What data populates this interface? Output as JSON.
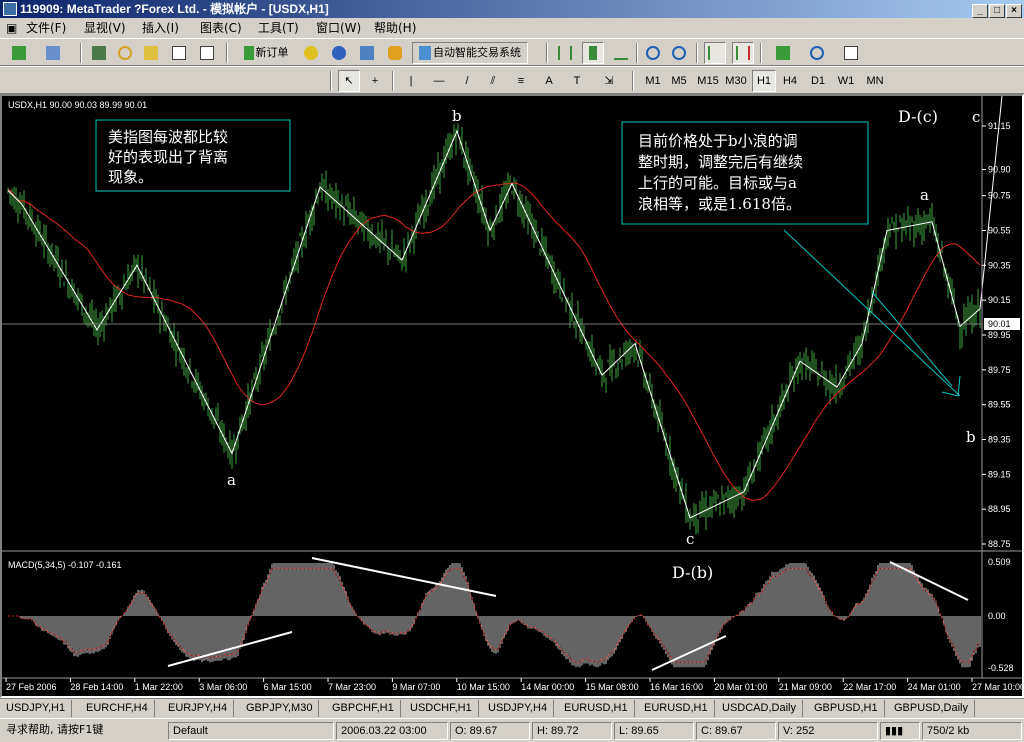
{
  "window": {
    "title": "119909: MetaTrader ?Forex Ltd. - 模拟帐户 - [USDX,H1]",
    "min": "_",
    "max": "□",
    "close": "×"
  },
  "menu": [
    "文件(F)",
    "显视(V)",
    "插入(I)",
    "图表(C)",
    "工具(T)",
    "窗口(W)",
    "帮助(H)"
  ],
  "toolbar": {
    "new_order": "新订单",
    "expert": "自动智能交易系统",
    "timeframes": [
      "M1",
      "M5",
      "M15",
      "M30",
      "H1",
      "H4",
      "D1",
      "W1",
      "MN"
    ],
    "active_timeframe": "H1"
  },
  "chart": {
    "header": "USDX,H1  90.00 90.03 89.99 90.01",
    "current_price": "90.01",
    "price_ticks": [
      "91.15",
      "90.90",
      "90.75",
      "90.55",
      "90.35",
      "90.15",
      "89.95",
      "89.75",
      "89.55",
      "89.35",
      "89.15",
      "88.95",
      "88.75"
    ],
    "macd_header": "MACD(5,34,5) -0.107 -0.161",
    "macd_ticks": [
      "0.509",
      "0.00",
      "-0.528"
    ],
    "time_labels": [
      "27 Feb 2006",
      "28 Feb 14:00",
      "1 Mar 22:00",
      "3 Mar 06:00",
      "6 Mar 15:00",
      "7 Mar 23:00",
      "9 Mar 07:00",
      "10 Mar 15:00",
      "14 Mar 00:00",
      "15 Mar 08:00",
      "16 Mar 16:00",
      "20 Mar 01:00",
      "21 Mar 09:00",
      "22 Mar 17:00",
      "24 Mar 01:00",
      "27 Mar 10:00"
    ],
    "note_left": [
      "美指图每波都比较",
      "好的表现出了背离",
      "现象。"
    ],
    "note_right": [
      "目前价格处于b小浪的调",
      "整时期，调整完后有继续",
      "上行的可能。目标或与a",
      "浪相等，或是1.618倍。"
    ],
    "wave_labels": {
      "a1": "a",
      "b1": "b",
      "c1": "c",
      "a2": "a",
      "b2": "b",
      "c2": "c",
      "dc": "D-(c)",
      "db": "D-(b)"
    },
    "colors": {
      "candle": "#3fa33f",
      "ma": "#e0281e",
      "wave": "#ffffff",
      "note_border": "#00c8c8",
      "macd_hist": "#c8c8c8",
      "macd_signal": "#e0281e"
    }
  },
  "tabs": [
    "USDJPY,H1",
    "EURCHF,H4",
    "EURJPY,H4",
    "GBPJPY,M30",
    "GBPCHF,H1",
    "USDCHF,H1",
    "USDJPY,H4",
    "EURUSD,H1",
    "EURUSD,H1",
    "USDCAD,Daily",
    "GBPUSD,H1",
    "GBPUSD,Daily"
  ],
  "active_tab": "USDX,H1",
  "status": {
    "help": "寻求帮助, 请按F1键",
    "profile": "Default",
    "datetime": "2006.03.22 03:00",
    "open": "O: 89.67",
    "high": "H: 89.72",
    "low": "L: 89.65",
    "close": "C: 89.67",
    "volume": "V: 252",
    "traffic": "750/2 kb"
  }
}
